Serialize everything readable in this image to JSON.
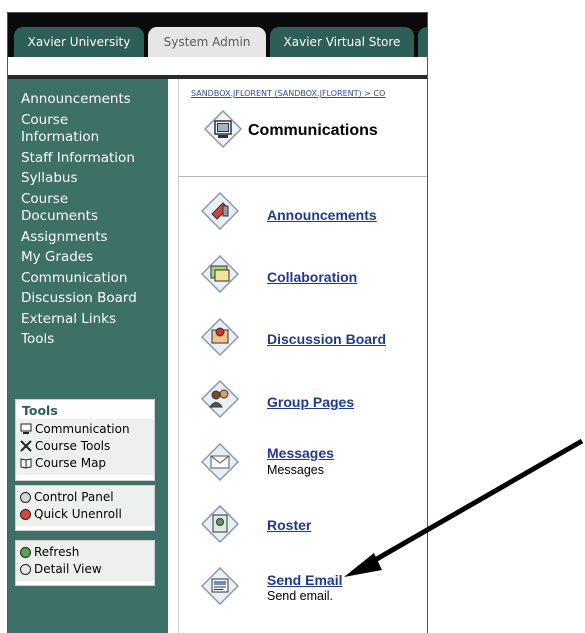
{
  "tabs": [
    {
      "label": "Xavier University"
    },
    {
      "label": "System Admin"
    },
    {
      "label": "Xavier Virtual Store"
    }
  ],
  "sidebar": {
    "items": [
      {
        "label": "Announcements"
      },
      {
        "label": "Course"
      },
      {
        "label": "Information"
      },
      {
        "label": "Staff Information"
      },
      {
        "label": "Syllabus"
      },
      {
        "label": "Course"
      },
      {
        "label": "Documents"
      },
      {
        "label": "Assignments"
      },
      {
        "label": "My Grades"
      },
      {
        "label": "Communication"
      },
      {
        "label": "Discussion Board"
      },
      {
        "label": "External Links"
      },
      {
        "label": "Tools"
      }
    ]
  },
  "tools_box": {
    "title": "Tools",
    "items": [
      {
        "label": "Communication",
        "icon": "monitor-icon"
      },
      {
        "label": "Course Tools",
        "icon": "tools-icon"
      },
      {
        "label": "Course Map",
        "icon": "map-book-icon"
      }
    ]
  },
  "control_box": {
    "items": [
      {
        "label": "Control Panel",
        "icon": "control-panel-icon"
      },
      {
        "label": "Quick Unenroll",
        "icon": "unenroll-icon"
      }
    ]
  },
  "view_box": {
    "items": [
      {
        "label": "Refresh",
        "icon": "refresh-icon"
      },
      {
        "label": "Detail View",
        "icon": "detail-view-icon"
      }
    ]
  },
  "breadcrumb": {
    "link": "SANDBOX.JFLORENT (SANDBOX.JFLORENT)",
    "rest": " > CO"
  },
  "page": {
    "title": "Communications",
    "icon": "communications-icon"
  },
  "items": [
    {
      "label": "Announcements",
      "desc": "",
      "icon": "announcements-icon"
    },
    {
      "label": "Collaboration",
      "desc": "",
      "icon": "collaboration-icon"
    },
    {
      "label": "Discussion Board",
      "desc": "",
      "icon": "discussion-board-icon"
    },
    {
      "label": "Group Pages",
      "desc": "",
      "icon": "group-pages-icon"
    },
    {
      "label": "Messages",
      "desc": "Messages",
      "icon": "messages-icon"
    },
    {
      "label": "Roster",
      "desc": "",
      "icon": "roster-icon"
    },
    {
      "label": "Send Email",
      "desc": "Send email.",
      "icon": "send-email-icon"
    }
  ],
  "colors": {
    "sidebar": "#3d7167",
    "tab": "#2d5e58",
    "link": "#1f3a8a"
  }
}
